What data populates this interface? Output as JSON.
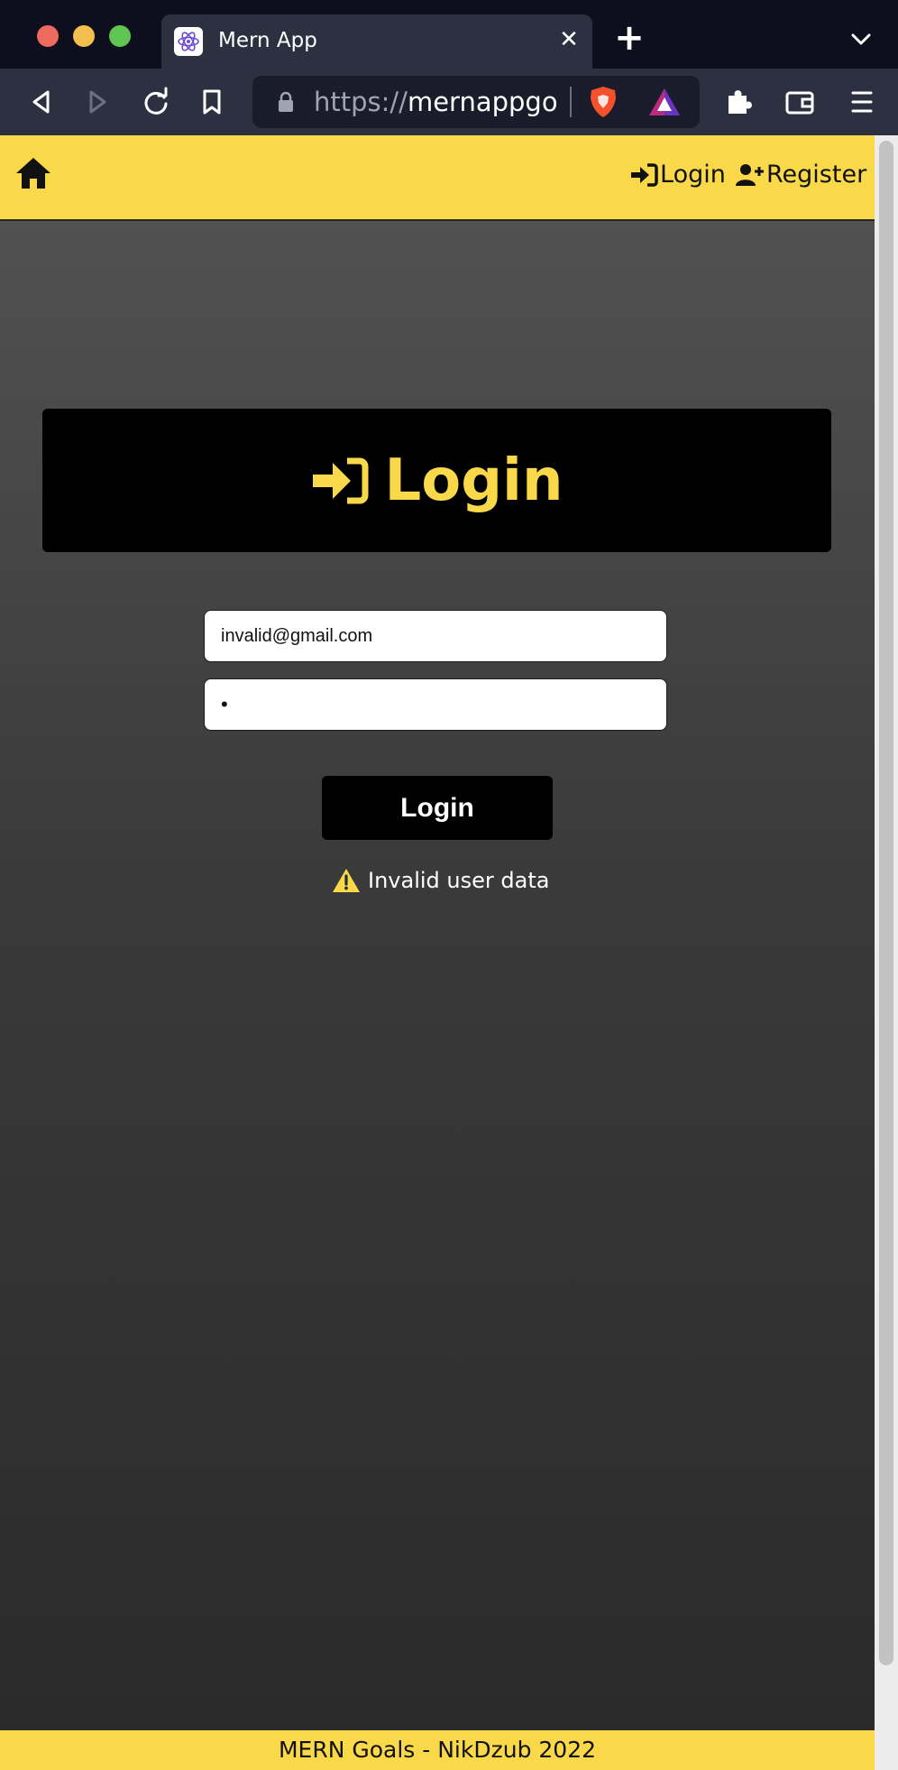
{
  "browser": {
    "tab_title": "Mern App",
    "url_scheme": "https://",
    "url_host": "mernappgo..."
  },
  "app": {
    "nav": {
      "login_label": "Login",
      "register_label": "Register"
    },
    "heading": "Login",
    "form": {
      "email_value": "invalid@gmail.com",
      "password_value": "•",
      "submit_label": "Login"
    },
    "error_message": "Invalid user data",
    "footer": "MERN Goals - NikDzub 2022",
    "colors": {
      "accent": "#f9d849",
      "banner": "#000000",
      "error_icon": "#f9d849"
    }
  }
}
